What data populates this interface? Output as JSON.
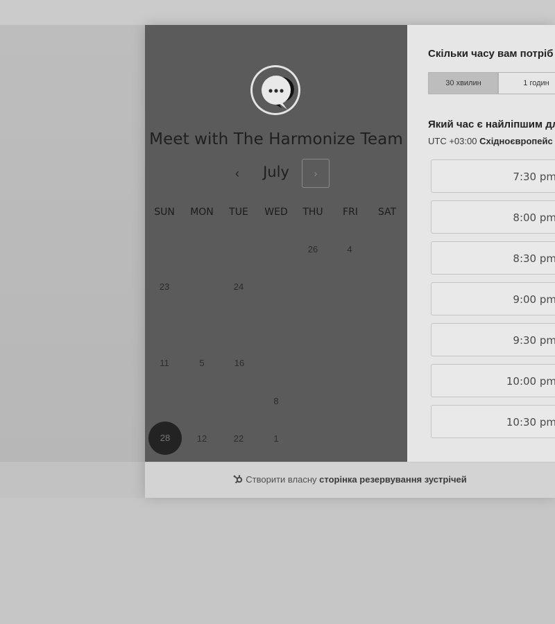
{
  "meeting": {
    "title": "Meet with The Harmonize Team"
  },
  "calendar": {
    "month": "July",
    "prev_icon": "chevron-left-icon",
    "next_icon": "chevron-right-icon",
    "weekdays": [
      "SUN",
      "MON",
      "TUE",
      "WED",
      "THU",
      "FRI",
      "SAT"
    ],
    "days": {
      "r1_thu": "26",
      "r1_fri": "4",
      "r2_sun": "23",
      "r2_tue": "24",
      "r3_sun": "11",
      "r3_mon": "5",
      "r3_tue": "16",
      "r4_wed": "8",
      "r5_sun": "28",
      "r5_mon": "12",
      "r5_tue": "22",
      "r5_wed": "1"
    },
    "selected_day": "28"
  },
  "duration": {
    "question": "Скільки часу вам потріб",
    "options": [
      "30 хвилин",
      "1 годин"
    ],
    "selected": "30 хвилин"
  },
  "time": {
    "question": "Який час є найліпшим дл",
    "timezone_prefix": "UTC +03:00",
    "timezone_name": "Східноєвропейс",
    "slots": [
      "7:30 pm",
      "8:00 pm",
      "8:30 pm",
      "9:00 pm",
      "9:30 pm",
      "10:00 pm",
      "10:30 pm"
    ]
  },
  "footer": {
    "icon": "sprocket-icon",
    "text_plain": "Створити власну",
    "text_bold": "сторінка резервування зустрічей"
  }
}
